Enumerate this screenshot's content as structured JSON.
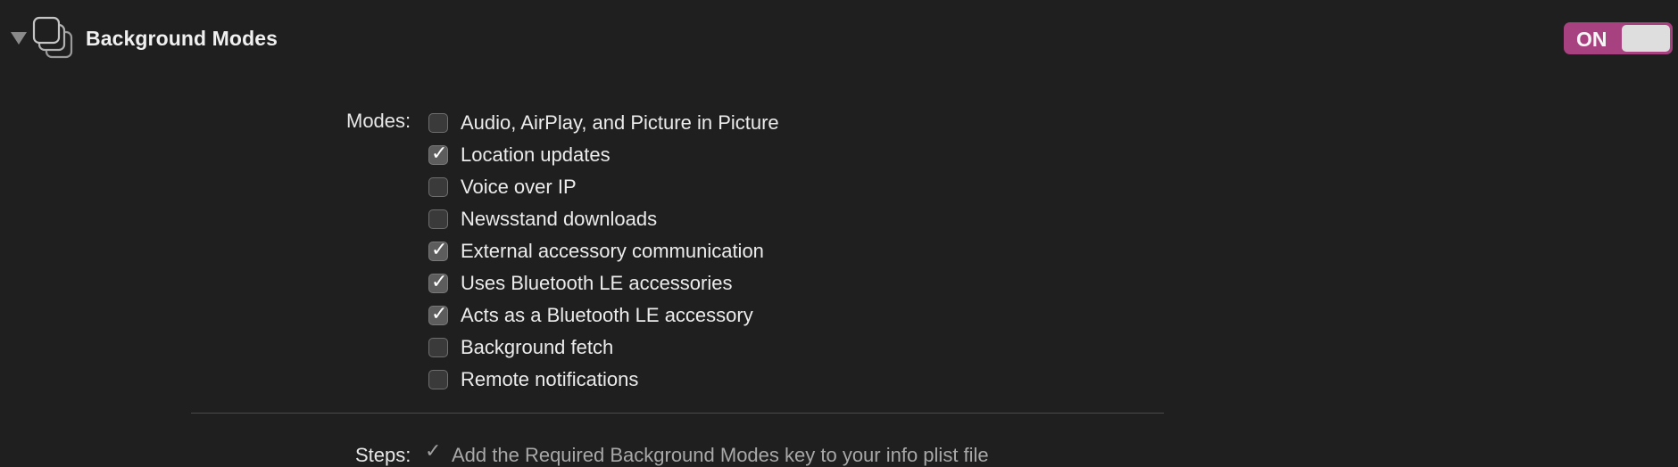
{
  "header": {
    "title": "Background Modes",
    "icon": "background-modes-icon",
    "toggle": {
      "label": "ON",
      "state": "on",
      "accent": "#a8417f"
    }
  },
  "modes": {
    "label": "Modes:",
    "options": [
      {
        "label": "Audio, AirPlay, and Picture in Picture",
        "checked": false
      },
      {
        "label": "Location updates",
        "checked": true
      },
      {
        "label": "Voice over IP",
        "checked": false
      },
      {
        "label": "Newsstand downloads",
        "checked": false
      },
      {
        "label": "External accessory communication",
        "checked": true
      },
      {
        "label": "Uses Bluetooth LE accessories",
        "checked": true
      },
      {
        "label": "Acts as a Bluetooth LE accessory",
        "checked": true
      },
      {
        "label": "Background fetch",
        "checked": false
      },
      {
        "label": "Remote notifications",
        "checked": false
      }
    ]
  },
  "steps": {
    "label": "Steps:",
    "items": [
      {
        "text": "Add the Required Background Modes key to your info plist file",
        "done": true
      }
    ]
  },
  "colors": {
    "background": "#1f1f1f",
    "toggle_on": "#a8417f"
  }
}
